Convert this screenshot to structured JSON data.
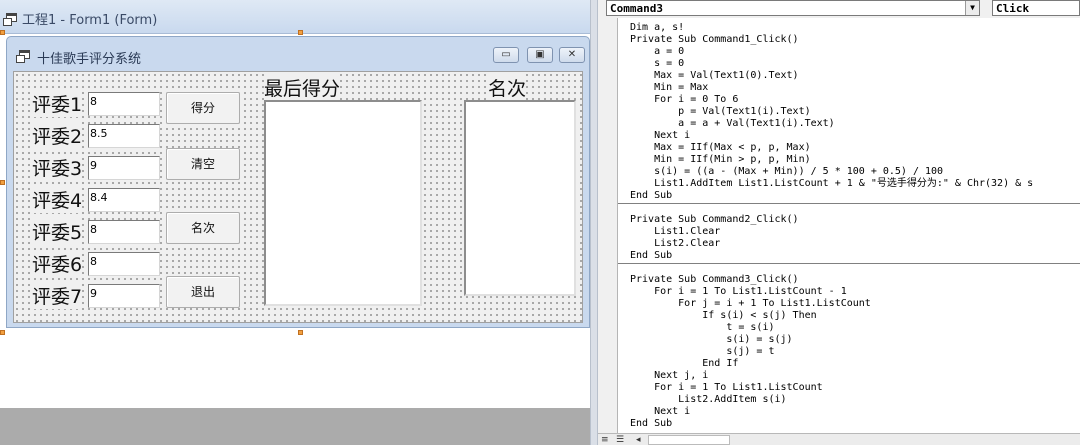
{
  "designer": {
    "title": "工程1 - Form1 (Form)",
    "form": {
      "title": "十佳歌手评分系统",
      "caption_buttons": {
        "minimize": "▭",
        "maximize": "▣",
        "close": "✕"
      },
      "judges": [
        {
          "label": "评委1",
          "value": "8"
        },
        {
          "label": "评委2",
          "value": "8.5"
        },
        {
          "label": "评委3",
          "value": "9"
        },
        {
          "label": "评委4",
          "value": "8.4"
        },
        {
          "label": "评委5",
          "value": "8"
        },
        {
          "label": "评委6",
          "value": "8"
        },
        {
          "label": "评委7",
          "value": "9"
        }
      ],
      "buttons": {
        "score": "得分",
        "clear": "清空",
        "rank": "名次",
        "exit": "退出"
      },
      "final_score_label": "最后得分",
      "rank_label": "名次"
    }
  },
  "code_window": {
    "object_combo": "Command3",
    "proc_combo": "Click",
    "combo_arrow": "▼",
    "lines": [
      "Dim a, s!",
      "Private Sub Command1_Click()",
      "    a = 0",
      "    s = 0",
      "    Max = Val(Text1(0).Text)",
      "    Min = Max",
      "    For i = 0 To 6",
      "        p = Val(Text1(i).Text)",
      "        a = a + Val(Text1(i).Text)",
      "    Next i",
      "    Max = IIf(Max < p, p, Max)",
      "    Min = IIf(Min > p, p, Min)",
      "    s(i) = ((a - (Max + Min)) / 5 * 100 + 0.5) / 100",
      "    List1.AddItem List1.ListCount + 1 & \"号选手得分为:\" & Chr(32) & s",
      "End Sub",
      "",
      "Private Sub Command2_Click()",
      "    List1.Clear",
      "    List2.Clear",
      "End Sub",
      "",
      "Private Sub Command3_Click()",
      "    For i = 1 To List1.ListCount - 1",
      "        For j = i + 1 To List1.ListCount",
      "            If s(i) < s(j) Then",
      "                t = s(i)",
      "                s(i) = s(j)",
      "                s(j) = t",
      "            End If",
      "    Next j, i",
      "    For i = 1 To List1.ListCount",
      "        List2.AddItem s(i)",
      "    Next i",
      "End Sub"
    ]
  }
}
